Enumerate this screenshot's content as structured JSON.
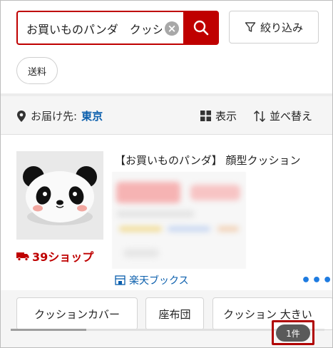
{
  "search": {
    "query": "お買いものパンダ　クッシ",
    "clear_symbol": "×"
  },
  "filter": {
    "label": "絞り込み"
  },
  "chips": {
    "shipping": "送料"
  },
  "delivery": {
    "prefix": "お届け先:",
    "city": "東京"
  },
  "toolbar": {
    "view_label": "表示",
    "sort_label": "並べ替え"
  },
  "product": {
    "title": "【お買いものパンダ】 顔型クッション",
    "shop_badge": "39ショップ",
    "store": "楽天ブックス",
    "more": "•••"
  },
  "related": {
    "items": [
      "クッションカバー",
      "座布団",
      "クッション 大きい"
    ]
  },
  "result_count": "1件",
  "colors": {
    "brand": "#bf0000",
    "link": "#0b5fad",
    "more": "#1e7be0"
  },
  "icons": {
    "search": "search-icon",
    "filter": "filter-icon",
    "location": "location-pin-icon",
    "grid": "grid-view-icon",
    "sort": "sort-icon",
    "truck": "truck-icon",
    "store": "store-icon"
  }
}
